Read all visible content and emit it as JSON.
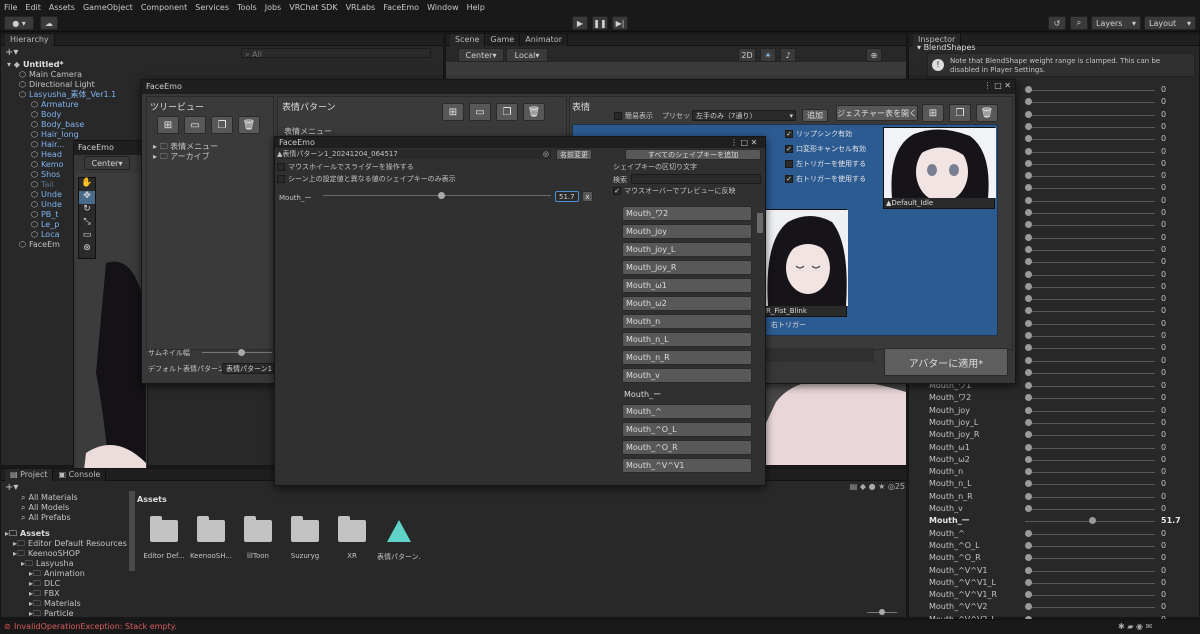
{
  "menubar": [
    "File",
    "Edit",
    "Assets",
    "GameObject",
    "Component",
    "Services",
    "Tools",
    "Jobs",
    "VRChat SDK",
    "VRLabs",
    "FaceEmo",
    "Window",
    "Help"
  ],
  "toolbar": {
    "layers": "Layers",
    "layout": "Layout",
    "account": "●"
  },
  "hierarchy": {
    "tab": "Hierarchy",
    "search_placeholder": "All",
    "items": [
      {
        "label": "Untitled*",
        "indent": 0,
        "color": "#e0e0e0",
        "bold": true
      },
      {
        "label": "Main Camera",
        "indent": 1,
        "color": "#c4c4c4"
      },
      {
        "label": "Directional Light",
        "indent": 1,
        "color": "#c4c4c4"
      },
      {
        "label": "Lasyusha_素体_Ver1.1",
        "indent": 1,
        "color": "#7fb4f0"
      },
      {
        "label": "Armature",
        "indent": 2,
        "color": "#7fb4f0"
      },
      {
        "label": "Body",
        "indent": 2,
        "color": "#7fb4f0"
      },
      {
        "label": "Body_base",
        "indent": 2,
        "color": "#7fb4f0"
      },
      {
        "label": "Hair_long",
        "indent": 2,
        "color": "#7fb4f0"
      },
      {
        "label": "Hair...",
        "indent": 2,
        "color": "#7fb4f0"
      },
      {
        "label": "Head",
        "indent": 2,
        "color": "#7fb4f0"
      },
      {
        "label": "Kemo",
        "indent": 2,
        "color": "#7fb4f0"
      },
      {
        "label": "Shos",
        "indent": 2,
        "color": "#7fb4f0"
      },
      {
        "label": "Tail",
        "indent": 2,
        "color": "#5a6e86"
      },
      {
        "label": "Unde",
        "indent": 2,
        "color": "#7fb4f0"
      },
      {
        "label": "Unde",
        "indent": 2,
        "color": "#7fb4f0"
      },
      {
        "label": "PB_t",
        "indent": 2,
        "color": "#7fb4f0"
      },
      {
        "label": "Le_p",
        "indent": 2,
        "color": "#7fb4f0"
      },
      {
        "label": "Loca",
        "indent": 2,
        "color": "#7fb4f0"
      },
      {
        "label": "FaceEm",
        "indent": 1,
        "color": "#c4c4c4"
      }
    ]
  },
  "scene": {
    "tabs": [
      "Scene",
      "Game",
      "Animator"
    ],
    "center": "Center",
    "local": "Local",
    "mode2d": "2D"
  },
  "small_window": {
    "title": "FaceEmo",
    "center": "Center"
  },
  "faceemo": {
    "title": "FaceEmo",
    "tree_title": "ツリービュー",
    "tree_items": [
      "表情メニュー",
      "アーカイブ"
    ],
    "pattern_title": "表情パターン",
    "pattern_menu": "表情メニュー",
    "emotion_title": "表情",
    "simple_view": "簡易表示",
    "preset_label": "プリセット",
    "preset_value": "左手のみ（7通り）",
    "add": "追加",
    "gesture_table": "ジェスチャー表を開く",
    "options": [
      "リップシンク有効",
      "口変形キャンセル有効",
      "左トリガーを使用する",
      "右トリガーを使用する"
    ],
    "options_checked": [
      true,
      true,
      false,
      true
    ],
    "thumb_default": "Default_Idle",
    "thumb_fist": "R_Fist_Blink",
    "right_trigger": "右トリガー",
    "thumbnail_size": "サムネイル幅",
    "default_pattern_label": "デフォルト表情パターン",
    "default_pattern_value": "表情パターン1",
    "apply": "アバターに適用*"
  },
  "shapekey_window": {
    "title": "FaceEmo",
    "asset": "表情パターン1_20241204_064517",
    "rename": "名前変更",
    "option_scroll": "マウスホイールでスライダーを操作する",
    "option_diff": "シーン上の設定値と異なる値のシェイプキーのみ表示",
    "shape_name": "Mouth_ー",
    "shape_value": "51.7",
    "shape_fraction": 0.517,
    "remove": "x",
    "add_all": "すべてのシェイプキーを追加",
    "delimiter": "シェイプキーの区切り文字",
    "search": "検索",
    "preview": "マウスオーバーでプレビューに反映",
    "keys": [
      "Mouth_ワ2",
      "Mouth_joy",
      "Mouth_joy_L",
      "Mouth_joy_R",
      "Mouth_ω1",
      "Mouth_ω2",
      "Mouth_n",
      "Mouth_n_L",
      "Mouth_n_R",
      "Mouth_v",
      "Mouth_ー",
      "Mouth_^",
      "Mouth_^O_L",
      "Mouth_^O_R",
      "Mouth_^V^V1"
    ],
    "selected_key": "Mouth_ー"
  },
  "inspector": {
    "tab": "Inspector",
    "section": "BlendShapes",
    "note": "Note that BlendShape weight range is clamped. This can be disabled in Player Settings.",
    "unnamed_count": 24,
    "rows": [
      {
        "name": "Mouth_ワ1",
        "value": "0"
      },
      {
        "name": "Mouth_ワ2",
        "value": "0"
      },
      {
        "name": "Mouth_joy",
        "value": "0"
      },
      {
        "name": "Mouth_joy_L",
        "value": "0"
      },
      {
        "name": "Mouth_joy_R",
        "value": "0"
      },
      {
        "name": "Mouth_ω1",
        "value": "0"
      },
      {
        "name": "Mouth_ω2",
        "value": "0"
      },
      {
        "name": "Mouth_n",
        "value": "0"
      },
      {
        "name": "Mouth_n_L",
        "value": "0"
      },
      {
        "name": "Mouth_n_R",
        "value": "0"
      },
      {
        "name": "Mouth_v",
        "value": "0"
      },
      {
        "name": "Mouth_ー",
        "value": "51.7",
        "level": 0.517,
        "bold": true
      },
      {
        "name": "Mouth_^",
        "value": "0"
      },
      {
        "name": "Mouth_^O_L",
        "value": "0"
      },
      {
        "name": "Mouth_^O_R",
        "value": "0"
      },
      {
        "name": "Mouth_^V^V1",
        "value": "0"
      },
      {
        "name": "Mouth_^V^V1_L",
        "value": "0"
      },
      {
        "name": "Mouth_^V^V1_R",
        "value": "0"
      },
      {
        "name": "Mouth_^V^V2",
        "value": "0"
      },
      {
        "name": "Mouth_^V^V2_L",
        "value": "0"
      }
    ],
    "zero": "0"
  },
  "project": {
    "tabs": [
      "Project",
      "Console"
    ],
    "favorites": [
      "All Materials",
      "All Models",
      "All Prefabs"
    ],
    "tree": [
      {
        "label": "Assets",
        "indent": 0,
        "bold": true
      },
      {
        "label": "Editor Default Resources",
        "indent": 1
      },
      {
        "label": "KeenooSHOP",
        "indent": 1
      },
      {
        "label": "Lasyusha",
        "indent": 2
      },
      {
        "label": "Animation",
        "indent": 3
      },
      {
        "label": "DLC",
        "indent": 3
      },
      {
        "label": "FBX",
        "indent": 3
      },
      {
        "label": "Materials",
        "indent": 3
      },
      {
        "label": "Particle",
        "indent": 3
      }
    ],
    "breadcrumb": "Assets",
    "assets": [
      "Editor Def...",
      "KeenooSH...",
      "lilToon",
      "Suzuryg",
      "XR",
      "表情パターン..."
    ],
    "count": "25"
  },
  "statusbar": {
    "error": "InvalidOperationException: Stack empty."
  }
}
